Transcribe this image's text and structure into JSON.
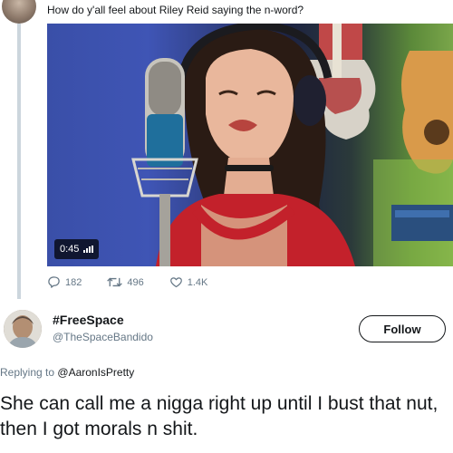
{
  "original_tweet": {
    "text": "How do y'all feel about Riley Reid saying the n-word?",
    "video": {
      "duration": "0:45"
    },
    "stats": {
      "replies": "182",
      "retweets": "496",
      "likes": "1.4K"
    }
  },
  "reply_tweet": {
    "display_name": "#FreeSpace",
    "handle": "@TheSpaceBandido",
    "follow_label": "Follow",
    "replying_prefix": "Replying to",
    "replying_to": "@AaronIsPretty",
    "text": "She can call me a nigga right up until I bust that nut, then I got morals n shit."
  },
  "icons": {
    "reply": "reply-icon",
    "retweet": "retweet-icon",
    "like": "heart-icon",
    "signal": "signal-bars-icon"
  },
  "colors": {
    "secondary_text": "#657786",
    "primary_text": "#14171a",
    "thread_line": "#ccd6dd"
  }
}
